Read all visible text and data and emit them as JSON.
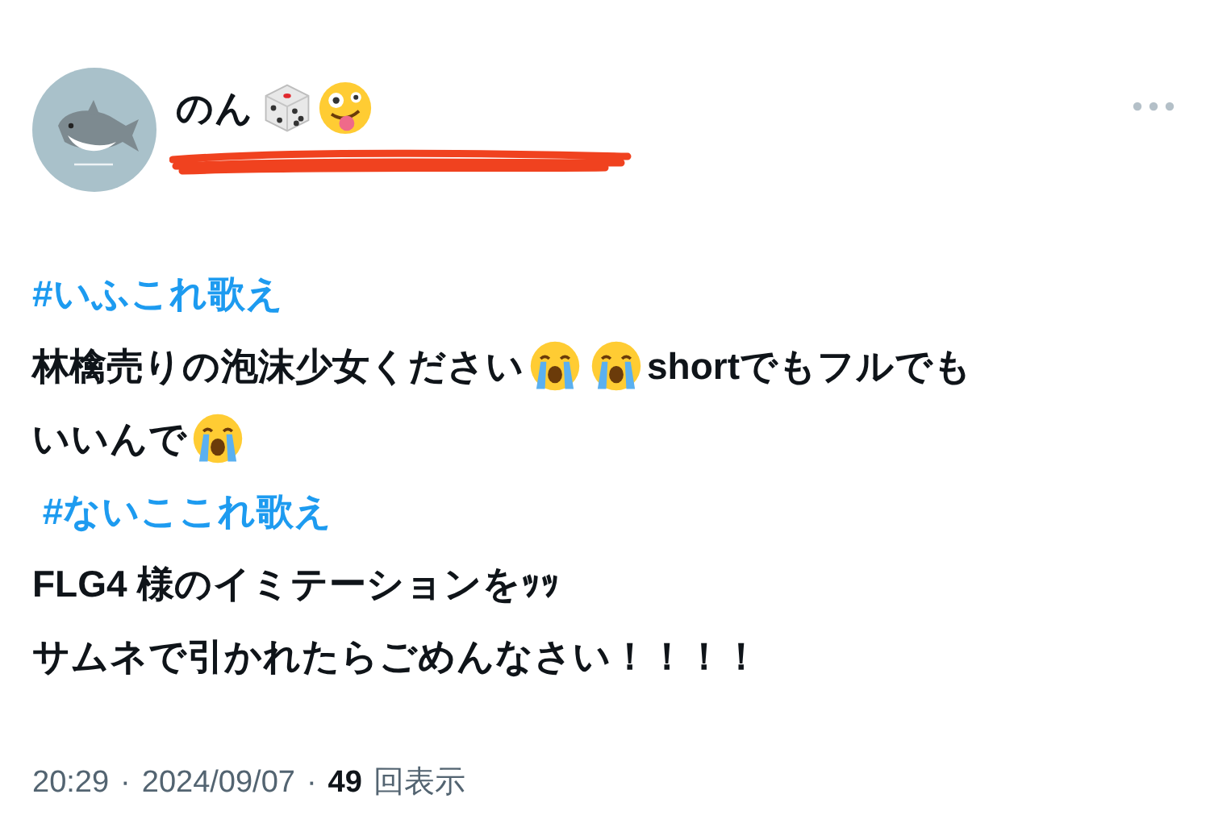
{
  "author": {
    "name": "のん",
    "emoji": [
      {
        "kind": "dice"
      },
      {
        "kind": "zany"
      }
    ]
  },
  "post": {
    "lines": [
      [
        {
          "kind": "hashtag",
          "text": "#いふこれ歌え"
        }
      ],
      [
        {
          "kind": "text",
          "text": "林檎売りの泡沫少女ください"
        },
        {
          "kind": "crying"
        },
        {
          "kind": "crying"
        },
        {
          "kind": "text",
          "text": "shortでもフルでも"
        }
      ],
      [
        {
          "kind": "text",
          "text": "いいんで"
        },
        {
          "kind": "crying"
        }
      ],
      [
        {
          "kind": "hashtag",
          "text": " #ないここれ歌え"
        }
      ],
      [
        {
          "kind": "text",
          "text": "FLG4 様のイミテーションをｯｯ"
        }
      ],
      [
        {
          "kind": "text",
          "text": "サムネで引かれたらごめんなさい！！！！"
        }
      ]
    ]
  },
  "footer": [
    {
      "kind": "muted",
      "text": "20:29"
    },
    {
      "kind": "muted",
      "text": "·"
    },
    {
      "kind": "muted",
      "text": "2024/09/07"
    },
    {
      "kind": "muted",
      "text": "·"
    },
    {
      "kind": "strong",
      "text": "49"
    },
    {
      "kind": "muted",
      "text": "回表示"
    }
  ]
}
